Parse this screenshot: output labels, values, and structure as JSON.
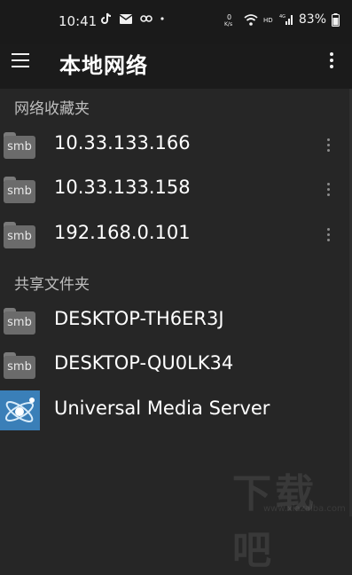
{
  "status_bar": {
    "time": "10:41",
    "network_speed": "0 K/s",
    "battery": "83%"
  },
  "app_bar": {
    "title": "本地网络"
  },
  "sections": [
    {
      "header": "网络收藏夹",
      "items": [
        {
          "icon": "smb",
          "label": "10.33.133.166"
        },
        {
          "icon": "smb",
          "label": "10.33.133.158"
        },
        {
          "icon": "smb",
          "label": "192.168.0.101"
        }
      ]
    },
    {
      "header": "共享文件夹",
      "items": [
        {
          "icon": "smb",
          "label": "DESKTOP-TH6ER3J"
        },
        {
          "icon": "smb",
          "label": "DESKTOP-QU0LK34"
        },
        {
          "icon": "ums-icon",
          "label": "Universal Media Server"
        }
      ]
    }
  ],
  "watermark": {
    "text": "下载吧",
    "sub": "www.xiazaiba.com"
  },
  "colors": {
    "background": "#262626",
    "app_bar": "#1b1b1b",
    "section_header": "#bdbdbd",
    "smb_icon": "#6b6b6b",
    "ums_icon": "#3a7fb8"
  }
}
